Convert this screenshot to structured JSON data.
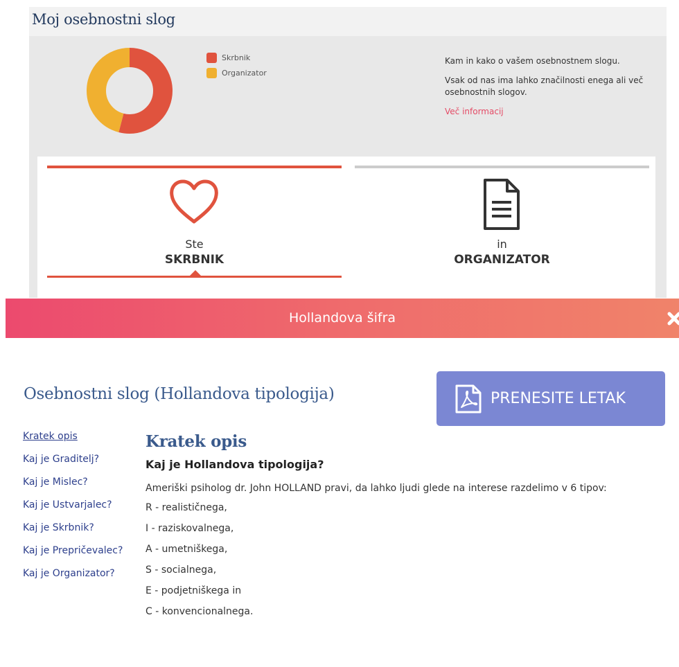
{
  "background": {
    "title": "Moj osebnostni slog",
    "donut": {
      "segments": [
        {
          "name": "Skrbnik",
          "fraction": 0.54,
          "color": "#e0533e"
        },
        {
          "name": "Organizator",
          "fraction": 0.46,
          "color": "#f0b030"
        }
      ]
    },
    "legend": [
      {
        "label": "Skrbnik",
        "color": "#e0533e"
      },
      {
        "label": "Organizator",
        "color": "#f0b030"
      }
    ],
    "info": {
      "line1": "Kam in kako o vašem osebnostnem slogu.",
      "line2": "Vsak od nas ima lahko značilnosti enega ali več osebnostnih slogov.",
      "link": "Več informacij"
    },
    "types": [
      {
        "prefix": "Ste",
        "name": "SKRBNIK",
        "icon": "heart-icon",
        "active": true,
        "bar_color": "#e0533e"
      },
      {
        "prefix": "in",
        "name": "ORGANIZATOR",
        "icon": "document-icon",
        "active": false,
        "bar_color": "#cccccc"
      }
    ]
  },
  "modal": {
    "title": "Hollandova šifra",
    "close_icon": "close-icon",
    "section_title": "Osebnostni slog (Hollandova tipologija)",
    "download_button": {
      "label": "PRENESITE LETAK",
      "icon": "pdf-icon"
    },
    "nav": [
      {
        "label": "Kratek opis",
        "active": true
      },
      {
        "label": "Kaj je Graditelj?",
        "active": false
      },
      {
        "label": "Kaj je Mislec?",
        "active": false
      },
      {
        "label": "Kaj je Ustvarjalec?",
        "active": false
      },
      {
        "label": "Kaj je Skrbnik?",
        "active": false
      },
      {
        "label": "Kaj je Prepričevalec?",
        "active": false
      },
      {
        "label": "Kaj je Organizator?",
        "active": false
      }
    ],
    "content": {
      "heading": "Kratek opis",
      "subheading": "Kaj je Hollandova tipologija?",
      "intro": "Ameriški psiholog dr. John HOLLAND pravi, da lahko ljudi glede na interese razdelimo v 6 tipov:",
      "types": [
        "R - realističnega,",
        "I - raziskovalnega,",
        "A - umetniškega,",
        "S - socialnega,",
        "E - podjetniškega in",
        "C - konvencionalnega."
      ]
    }
  },
  "colors": {
    "accent": "#e0533e",
    "secondary": "#f0b030",
    "link": "#2d3f8c",
    "title": "#3a5a8c",
    "button": "#7b87d3",
    "pink": "#e44b66"
  }
}
